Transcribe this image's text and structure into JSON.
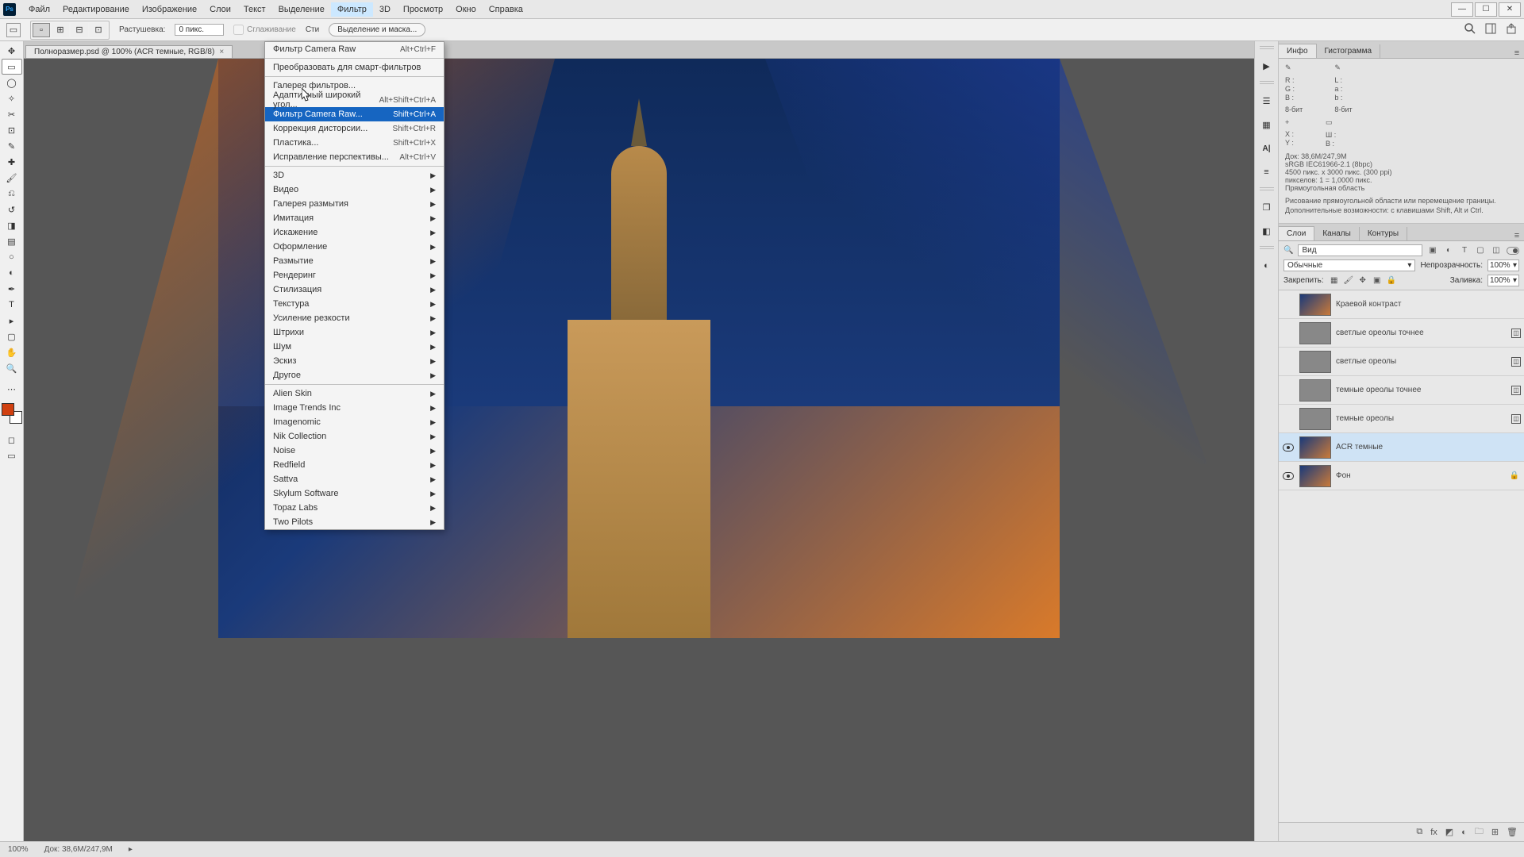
{
  "menubar": {
    "items": [
      "Файл",
      "Редактирование",
      "Изображение",
      "Слои",
      "Текст",
      "Выделение",
      "Фильтр",
      "3D",
      "Просмотр",
      "Окно",
      "Справка"
    ],
    "active_index": 6
  },
  "optionsbar": {
    "feather_label": "Растушевка:",
    "feather_value": "0 пикс.",
    "antialias_label": "Сглаживание",
    "style_label": "Сти",
    "select_mask_btn": "Выделение и маска..."
  },
  "document": {
    "tab_title": "Полноразмер.psd @ 100% (ACR темные, RGB/8)"
  },
  "dropdown": {
    "sections": [
      [
        {
          "label": "Фильтр Camera Raw",
          "shortcut": "Alt+Ctrl+F"
        }
      ],
      [
        {
          "label": "Преобразовать для смарт-фильтров"
        }
      ],
      [
        {
          "label": "Галерея фильтров..."
        },
        {
          "label": "Адаптивный широкий угол...",
          "shortcut": "Alt+Shift+Ctrl+A"
        },
        {
          "label": "Фильтр Camera Raw...",
          "shortcut": "Shift+Ctrl+A",
          "highlighted": true
        },
        {
          "label": "Коррекция дисторсии...",
          "shortcut": "Shift+Ctrl+R"
        },
        {
          "label": "Пластика...",
          "shortcut": "Shift+Ctrl+X"
        },
        {
          "label": "Исправление перспективы...",
          "shortcut": "Alt+Ctrl+V"
        }
      ],
      [
        {
          "label": "3D",
          "submenu": true
        },
        {
          "label": "Видео",
          "submenu": true
        },
        {
          "label": "Галерея размытия",
          "submenu": true
        },
        {
          "label": "Имитация",
          "submenu": true
        },
        {
          "label": "Искажение",
          "submenu": true
        },
        {
          "label": "Оформление",
          "submenu": true
        },
        {
          "label": "Размытие",
          "submenu": true
        },
        {
          "label": "Рендеринг",
          "submenu": true
        },
        {
          "label": "Стилизация",
          "submenu": true
        },
        {
          "label": "Текстура",
          "submenu": true
        },
        {
          "label": "Усиление резкости",
          "submenu": true
        },
        {
          "label": "Штрихи",
          "submenu": true
        },
        {
          "label": "Шум",
          "submenu": true
        },
        {
          "label": "Эскиз",
          "submenu": true
        },
        {
          "label": "Другое",
          "submenu": true
        }
      ],
      [
        {
          "label": "Alien Skin",
          "submenu": true
        },
        {
          "label": "Image Trends Inc",
          "submenu": true
        },
        {
          "label": "Imagenomic",
          "submenu": true
        },
        {
          "label": "Nik Collection",
          "submenu": true
        },
        {
          "label": "Noise",
          "submenu": true
        },
        {
          "label": "Redfield",
          "submenu": true
        },
        {
          "label": "Sattva",
          "submenu": true
        },
        {
          "label": "Skylum Software",
          "submenu": true
        },
        {
          "label": "Topaz Labs",
          "submenu": true
        },
        {
          "label": "Two Pilots",
          "submenu": true
        }
      ]
    ]
  },
  "info_panel": {
    "tab1": "Инфо",
    "tab2": "Гистограмма",
    "rgb": {
      "R": "R :",
      "G": "G :",
      "B": "B :"
    },
    "lab": {
      "L": "L :",
      "a": "a :",
      "b": "b :"
    },
    "bit1": "8-бит",
    "bit2": "8-бит",
    "xy": {
      "X": "X :",
      "Y": "Y :"
    },
    "wh": {
      "W": "Ш :",
      "H": "В :"
    },
    "doc_size": "Док: 38,6M/247,9M",
    "profile": "sRGB IEC61966-2.1 (8bpc)",
    "dimensions": "4500 пикс. x 3000 пикс. (300 ppi)",
    "pixels": "пикселов: 1 = 1,0000 пикс.",
    "shape": "Прямоугольная область",
    "hint": "Рисование прямоугольной области или перемещение границы. Дополнительные возможности: с клавишами Shift, Alt и Ctrl."
  },
  "layers_panel": {
    "tab1": "Слои",
    "tab2": "Каналы",
    "tab3": "Контуры",
    "search_kind_label": "Вид",
    "blend_mode": "Обычные",
    "opacity_label": "Непрозрачность:",
    "opacity_value": "100%",
    "lock_label": "Закрепить:",
    "fill_label": "Заливка:",
    "fill_value": "100%",
    "layers": [
      {
        "name": "Краевой контраст",
        "thumb": "color",
        "visible": false,
        "smart": false,
        "locked": false
      },
      {
        "name": "светлые ореолы точнее",
        "thumb": "gray",
        "visible": false,
        "smart": true,
        "locked": false
      },
      {
        "name": "светлые ореолы",
        "thumb": "gray",
        "visible": false,
        "smart": true,
        "locked": false
      },
      {
        "name": "темные ореолы точнее",
        "thumb": "gray",
        "visible": false,
        "smart": true,
        "locked": false
      },
      {
        "name": "темные ореолы",
        "thumb": "gray",
        "visible": false,
        "smart": true,
        "locked": false
      },
      {
        "name": "ACR темные",
        "thumb": "color",
        "visible": true,
        "smart": false,
        "locked": false,
        "selected": true
      },
      {
        "name": "Фон",
        "thumb": "color",
        "visible": true,
        "smart": false,
        "locked": true
      }
    ]
  },
  "statusbar": {
    "zoom": "100%",
    "docinfo": "Док: 38,6M/247,9M"
  }
}
